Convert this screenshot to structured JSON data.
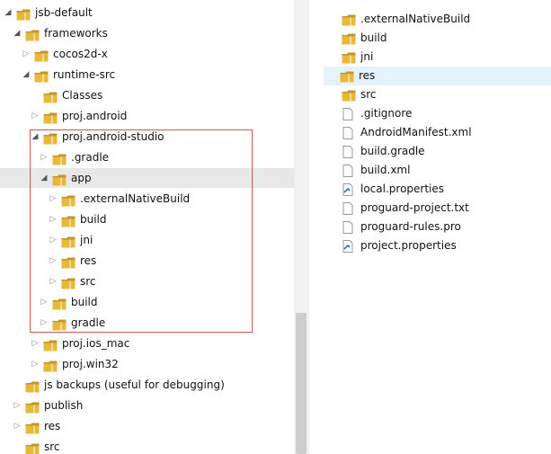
{
  "tree": [
    {
      "label": "jsb-default",
      "depth": 0,
      "expanded": true
    },
    {
      "label": "frameworks",
      "depth": 1,
      "expanded": true
    },
    {
      "label": "cocos2d-x",
      "depth": 2,
      "expanded": false
    },
    {
      "label": "runtime-src",
      "depth": 2,
      "expanded": true
    },
    {
      "label": "Classes",
      "depth": 3,
      "expanded": null
    },
    {
      "label": "proj.android",
      "depth": 3,
      "expanded": false
    },
    {
      "label": "proj.android-studio",
      "depth": 3,
      "expanded": true
    },
    {
      "label": ".gradle",
      "depth": 4,
      "expanded": false
    },
    {
      "label": "app",
      "depth": 4,
      "expanded": true,
      "selected": true
    },
    {
      "label": ".externalNativeBuild",
      "depth": 5,
      "expanded": false
    },
    {
      "label": "build",
      "depth": 5,
      "expanded": false
    },
    {
      "label": "jni",
      "depth": 5,
      "expanded": false
    },
    {
      "label": "res",
      "depth": 5,
      "expanded": false
    },
    {
      "label": "src",
      "depth": 5,
      "expanded": false
    },
    {
      "label": "build",
      "depth": 4,
      "expanded": false
    },
    {
      "label": "gradle",
      "depth": 4,
      "expanded": false
    },
    {
      "label": "proj.ios_mac",
      "depth": 3,
      "expanded": false
    },
    {
      "label": "proj.win32",
      "depth": 3,
      "expanded": false
    },
    {
      "label": "js backups (useful for debugging)",
      "depth": 1,
      "expanded": null
    },
    {
      "label": "publish",
      "depth": 1,
      "expanded": false
    },
    {
      "label": "res",
      "depth": 1,
      "expanded": false
    },
    {
      "label": "src",
      "depth": 1,
      "expanded": null
    }
  ],
  "files": [
    {
      "label": ".externalNativeBuild",
      "icon": "folder"
    },
    {
      "label": "build",
      "icon": "folder"
    },
    {
      "label": "jni",
      "icon": "folder"
    },
    {
      "label": "res",
      "icon": "folder",
      "selected": true
    },
    {
      "label": "src",
      "icon": "folder"
    },
    {
      "label": ".gitignore",
      "icon": "file"
    },
    {
      "label": "AndroidManifest.xml",
      "icon": "file"
    },
    {
      "label": "build.gradle",
      "icon": "file"
    },
    {
      "label": "build.xml",
      "icon": "file"
    },
    {
      "label": "local.properties",
      "icon": "properties"
    },
    {
      "label": "proguard-project.txt",
      "icon": "file"
    },
    {
      "label": "proguard-rules.pro",
      "icon": "file"
    },
    {
      "label": "project.properties",
      "icon": "properties"
    }
  ],
  "colors": {
    "folder": "#e8b938",
    "folder_dark": "#c8932a",
    "highlight": "#d9534f",
    "selected_row": "#e5f3fb"
  }
}
